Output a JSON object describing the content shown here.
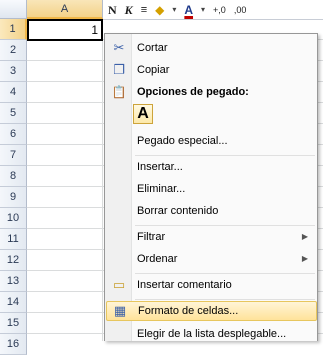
{
  "sheet": {
    "columns": [
      "A"
    ],
    "rows": [
      "1",
      "2",
      "3",
      "4",
      "5",
      "6",
      "7",
      "8",
      "9",
      "10",
      "11",
      "12",
      "13",
      "14",
      "15",
      "16"
    ],
    "selected_row": "1",
    "a1_value": "1"
  },
  "toolbar": {
    "bold": "N",
    "italic": "K",
    "align": "≡",
    "fill": "◆",
    "font_color": "A",
    "arrow": "▾",
    "dec1": "+,0",
    "dec2": ",00"
  },
  "context_menu": {
    "items": [
      {
        "label": "Cortar",
        "icon": "scissors-icon",
        "glyph": "✂"
      },
      {
        "label": "Copiar",
        "icon": "copy-icon",
        "glyph": "❐"
      },
      {
        "label": "Opciones de pegado:",
        "icon": "paste-icon",
        "glyph": "📋"
      },
      {
        "label": "A",
        "icon": "paste-keep-icon"
      },
      {
        "label": "Pegado especial..."
      },
      {
        "label": "Insertar..."
      },
      {
        "label": "Eliminar..."
      },
      {
        "label": "Borrar contenido"
      },
      {
        "label": "Filtrar"
      },
      {
        "label": "Ordenar"
      },
      {
        "label": "Insertar comentario",
        "icon": "comment-icon",
        "glyph": "▭"
      },
      {
        "label": "Formato de celdas...",
        "icon": "format-cells-icon",
        "glyph": "▦"
      },
      {
        "label": "Elegir de la lista desplegable..."
      }
    ],
    "submenu_arrow": "▶",
    "highlight_color": "#ffe39a"
  }
}
